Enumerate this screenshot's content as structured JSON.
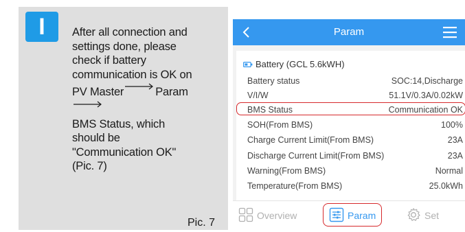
{
  "instruction": {
    "step_letter": "I",
    "line1": "After all connection and",
    "line2": "settings done, please",
    "line3": "check if battery",
    "line4": "communication is OK on",
    "line5a": "PV Master",
    "line5b": "Param",
    "line6": "BMS Status, which",
    "line7": "should be",
    "line8": "\"Communication OK\"",
    "line9": "(Pic. 7)",
    "pic_label": "Pic. 7",
    "badge_color": "#1f9be6",
    "panel_color": "#dfdfdf"
  },
  "app": {
    "title": "Param",
    "accent_color": "#3598ef",
    "back_icon": "chevron-left-icon",
    "menu_icon": "hamburger-menu-icon",
    "battery": {
      "header_title": "Battery (GCL 5.6kWH)",
      "rows": [
        {
          "label": "Battery status",
          "value": "SOC:14,Discharge"
        },
        {
          "label": "V/I/W",
          "value": "51.1V/0.3A/0.02kW"
        },
        {
          "label": "BMS Status",
          "value": "Communication OK"
        },
        {
          "label": "SOH(From BMS)",
          "value": "100%"
        },
        {
          "label": "Charge Current Limit(From BMS)",
          "value": "23A"
        },
        {
          "label": "Discharge Current Limit(From BMS)",
          "value": "23A"
        },
        {
          "label": "Warning(From BMS)",
          "value": "Normal"
        },
        {
          "label": "Temperature(From BMS)",
          "value": "25.0kWh"
        }
      ]
    },
    "nav": {
      "overview": "Overview",
      "param": "Param",
      "set": "Set",
      "active": "Param"
    },
    "highlight_color": "#d6282b"
  }
}
